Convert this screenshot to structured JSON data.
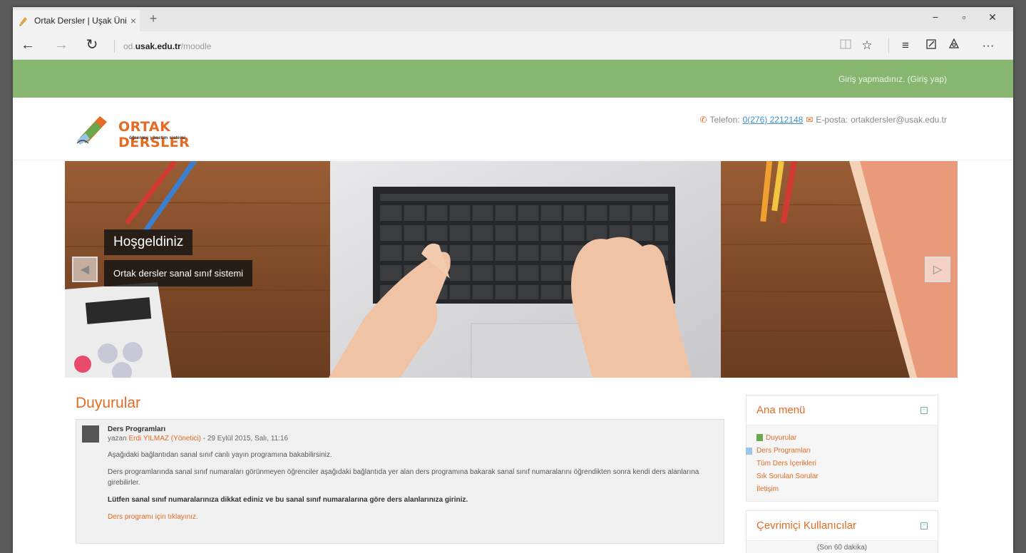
{
  "browser": {
    "tab_title": "Ortak Dersler | Uşak Üni",
    "tab_close": "×",
    "new_tab": "+",
    "url_prefix": "od.",
    "url_domain": "usak.edu.tr",
    "url_path": "/moodle",
    "minimize": "−",
    "maximize": "▫",
    "close": "✕",
    "back": "←",
    "forward": "→",
    "refresh": "↻",
    "more": "···"
  },
  "page": {
    "login_text": "Giriş yapmadınız. (Giriş yap)",
    "logo_title": "ORTAK DERSLER",
    "logo_subtitle": "öğrenme yönetim sistemi",
    "phone_label": "Telefon:",
    "phone_value": "0(276) 2212148",
    "email_label": "E-posta:",
    "email_value": "ortakdersler@usak.edu.tr",
    "colors": {
      "green_bar": "#86b66f",
      "accent": "#e36b23"
    }
  },
  "slider": {
    "title": "Hoşgeldiniz",
    "subtitle": "Ortak dersler sanal sınıf sistemi",
    "prev_icon": "◀",
    "next_icon": "▷"
  },
  "news": {
    "heading": "Duyurular",
    "post": {
      "subject": "Ders Programları",
      "by": "yazan",
      "author": "Erdi YILMAZ (Yönetici)",
      "date": "- 29 Eylül 2015, Salı, 11:16",
      "p1": "Aşağıdaki bağlantıdan sanal sınıf canlı yayın programına bakabilirsiniz.",
      "p2": "Ders programlarında sanal sınıf numaraları görünmeyen öğrenciler aşağıdaki bağlantıda yer alan ders programına bakarak sanal sınıf numaralarını öğrendikten sonra kendi ders alanlarına girebilirler.",
      "p3": "Lütfen sanal sınıf numaralarınıza dikkat ediniz ve bu sanal sınıf numaralarına göre ders alanlarınıza giriniz.",
      "link": "Ders programı için tıklayınız."
    }
  },
  "main_menu": {
    "title": "Ana menü",
    "items": [
      {
        "label": "Duyurular",
        "icon": "forum-icon"
      },
      {
        "label": "Ders Programları",
        "icon": "page-icon"
      },
      {
        "label": "Tüm Ders İçerikleri",
        "icon": "page-icon"
      },
      {
        "label": "Sık Sorulan Sorular",
        "icon": "page-icon"
      },
      {
        "label": "İletişim",
        "icon": "page-icon"
      }
    ]
  },
  "online_users": {
    "title": "Çevrimiçi Kullanıcılar",
    "subtitle": "(Son 60 dakika)"
  }
}
